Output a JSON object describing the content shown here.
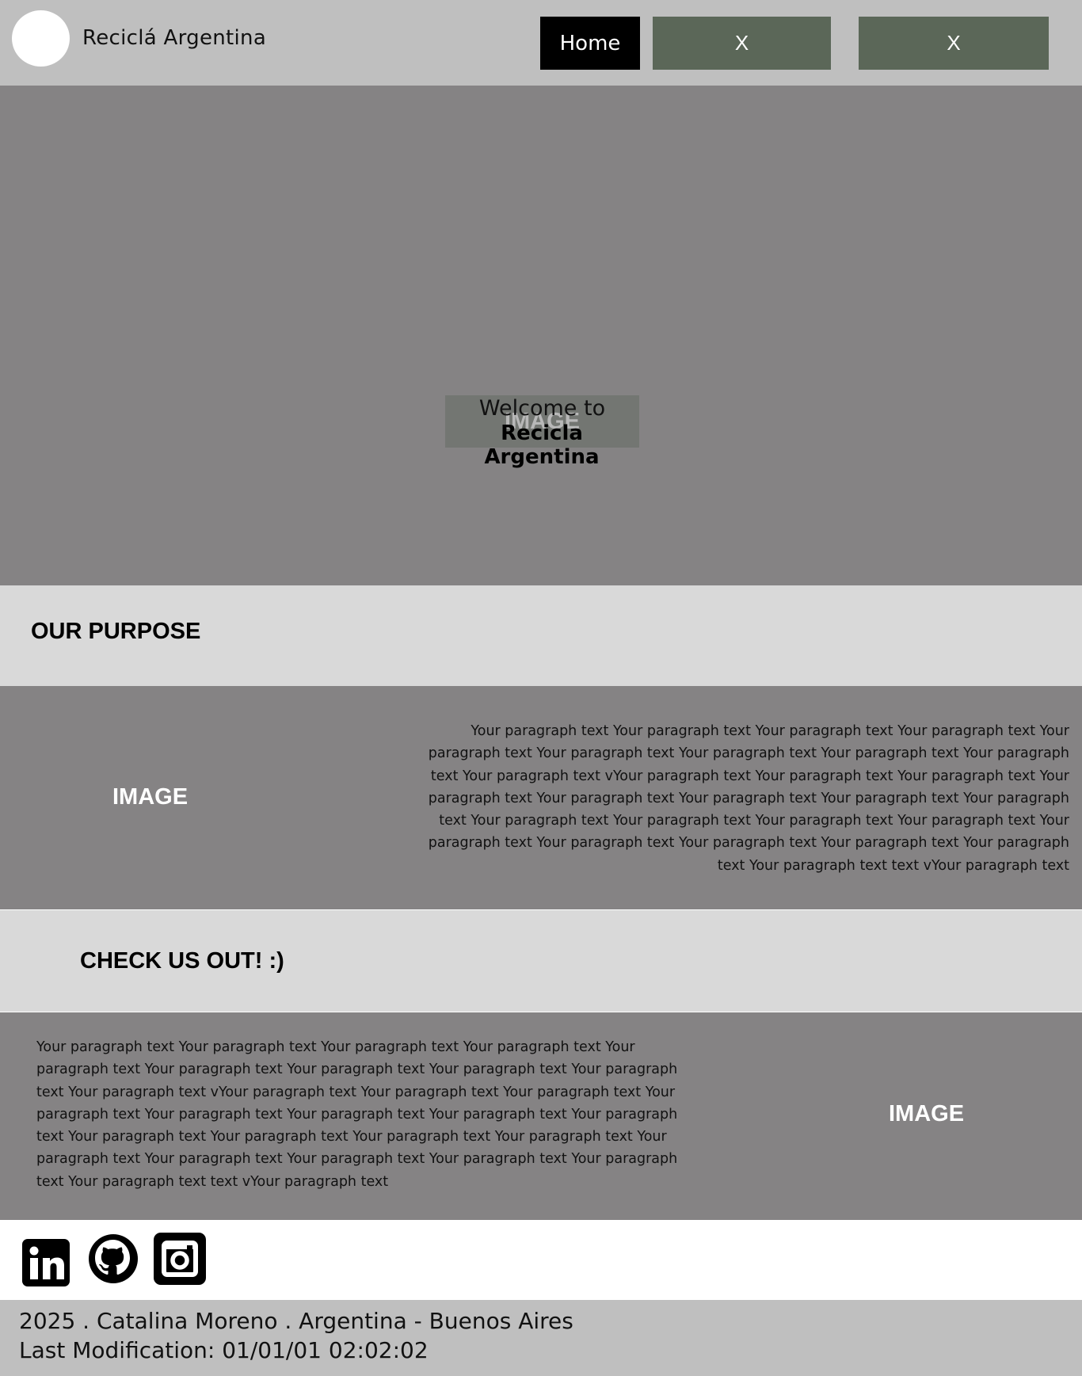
{
  "header": {
    "brand": "Reciclá Argentina",
    "nav": [
      {
        "label": "Home"
      },
      {
        "label": "X"
      },
      {
        "label": "X"
      }
    ]
  },
  "hero": {
    "image_label": "IMAGE",
    "welcome": "Welcome to",
    "title": "Recicla Argentina"
  },
  "purpose": {
    "title": "OUR PURPOSE",
    "image_label": "IMAGE",
    "paragraph": "Your paragraph text Your paragraph text Your paragraph text Your paragraph text Your paragraph text Your paragraph text Your paragraph text Your paragraph text Your paragraph text Your paragraph text vYour paragraph text Your paragraph text Your paragraph text Your paragraph text Your paragraph text Your paragraph text Your paragraph text Your paragraph text Your paragraph text Your paragraph text Your paragraph text Your paragraph text Your paragraph text Your paragraph text Your paragraph text Your paragraph text Your paragraph text Your paragraph text text vYour paragraph text"
  },
  "check": {
    "title": "CHECK US OUT! :)",
    "image_label": "IMAGE",
    "paragraph": "Your paragraph text Your paragraph text Your paragraph text Your paragraph text Your paragraph text Your paragraph text Your paragraph text Your paragraph text Your paragraph text Your paragraph text vYour paragraph text Your paragraph text Your paragraph text Your paragraph text Your paragraph text Your paragraph text Your paragraph text Your paragraph text Your paragraph text Your paragraph text Your paragraph text Your paragraph text Your paragraph text Your paragraph text Your paragraph text Your paragraph text Your paragraph text Your paragraph text text vYour paragraph text"
  },
  "social": {
    "icons": [
      "linkedin-icon",
      "github-icon",
      "instagram-icon"
    ]
  },
  "footer": {
    "line1": "2025 . Catalina Moreno . Argentina - Buenos Aires",
    "line2": "Last Modification: 01/01/01 02:02:02"
  },
  "colors": {
    "header_bg": "#bfbfbf",
    "hero_bg": "#858384",
    "band_bg": "#d9d9d9",
    "nav_active": "#000000",
    "nav_secondary": "#5b6758",
    "footer_bg": "#bfbfbf"
  }
}
